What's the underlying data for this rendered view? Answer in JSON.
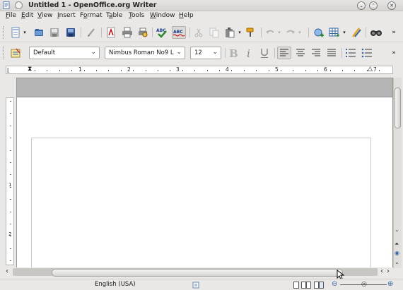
{
  "window": {
    "title": "Untitled 1 - OpenOffice.org Writer"
  },
  "menu": {
    "items": [
      {
        "label": "File",
        "accel": "F"
      },
      {
        "label": "Edit",
        "accel": "E"
      },
      {
        "label": "View",
        "accel": "V"
      },
      {
        "label": "Insert",
        "accel": "I"
      },
      {
        "label": "Format",
        "accel": "o"
      },
      {
        "label": "Table",
        "accel": "a"
      },
      {
        "label": "Tools",
        "accel": "T"
      },
      {
        "label": "Window",
        "accel": "W"
      },
      {
        "label": "Help",
        "accel": "H"
      }
    ]
  },
  "formatting": {
    "paragraph_style": "Default",
    "font_name": "Nimbus Roman No9 L",
    "font_size": "12"
  },
  "ruler": {
    "h_numbers": [
      "1",
      "2",
      "3",
      "4",
      "5",
      "6",
      "7"
    ],
    "v_numbers": [
      "1",
      "2"
    ]
  },
  "status": {
    "language": "English (USA)"
  },
  "colors": {
    "accent_blue": "#3465a4",
    "doc_header_grey": "#b4b4b4",
    "spellcheck_green": "#2e8b2e",
    "pdf_red": "#cc0000"
  },
  "icons": {
    "toolbar1": [
      "new-document-icon",
      "open-icon",
      "save-icon",
      "save-as-icon",
      "edit-file-icon",
      "export-pdf-icon",
      "print-icon",
      "print-preview-icon",
      "spellcheck-icon",
      "autospellcheck-icon",
      "cut-icon",
      "copy-icon",
      "paste-icon",
      "clone-formatting-icon",
      "undo-icon",
      "redo-icon",
      "hyperlink-icon",
      "table-icon",
      "show-draw-functions-icon",
      "find-icon"
    ],
    "toolbar2": [
      "styles-formatting-icon",
      "bold-icon",
      "italic-icon",
      "underline-icon",
      "align-left-icon",
      "align-center-icon",
      "align-right-icon",
      "justify-icon",
      "numbering-icon",
      "bullets-icon"
    ]
  }
}
